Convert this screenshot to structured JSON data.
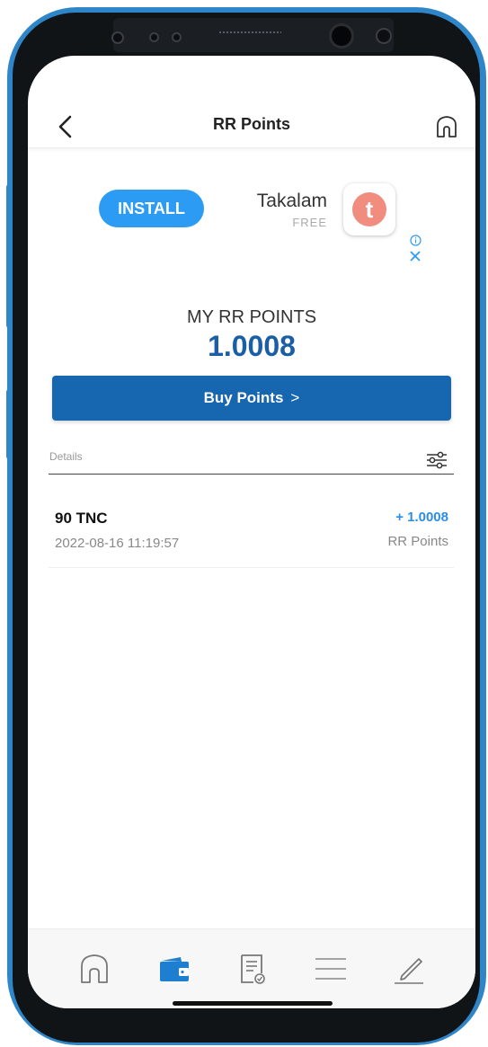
{
  "header": {
    "title": "RR Points",
    "back_icon": "chevron-left-icon",
    "home_icon": "home-icon"
  },
  "ad": {
    "install_label": "INSTALL",
    "app_name": "Takalam",
    "price": "FREE",
    "app_icon_letter": "t",
    "install_color": "#2b9bf4",
    "app_icon_color": "#f08d7e"
  },
  "points": {
    "label": "MY RR POINTS",
    "value": "1.0008",
    "buy_label": "Buy Points",
    "buy_chevron": ">",
    "buy_color": "#1766b0"
  },
  "details": {
    "label": "Details",
    "filter_icon": "sliders-icon"
  },
  "transactions": [
    {
      "title": "90 TNC",
      "date": "2022-08-16 11:19:57",
      "amount": "+ 1.0008",
      "unit": "RR Points"
    }
  ],
  "tabs": [
    {
      "icon": "home-icon",
      "active": false
    },
    {
      "icon": "wallet-icon",
      "active": true
    },
    {
      "icon": "document-icon",
      "active": false
    },
    {
      "icon": "menu-icon",
      "active": false
    },
    {
      "icon": "edit-icon",
      "active": false
    }
  ],
  "colors": {
    "accent": "#1a5ea8",
    "amount_positive": "#2b8de6",
    "frame": "#2e86c8"
  }
}
